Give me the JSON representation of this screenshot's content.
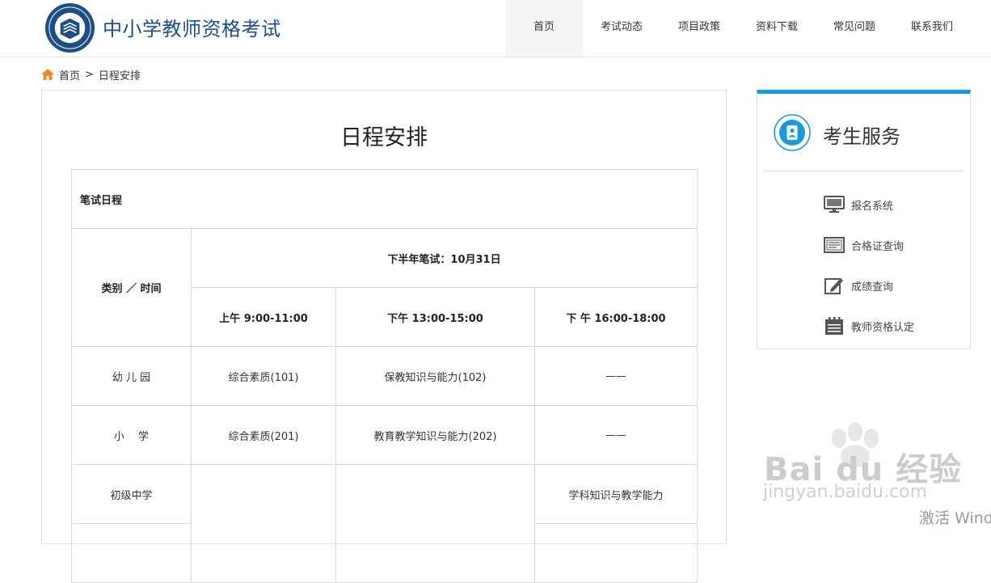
{
  "header": {
    "site_title": "中小学教师资格考试",
    "nav": [
      {
        "label": "首页",
        "active": true
      },
      {
        "label": "考试动态"
      },
      {
        "label": "项目政策"
      },
      {
        "label": "资料下载"
      },
      {
        "label": "常见问题"
      },
      {
        "label": "联系我们"
      }
    ]
  },
  "breadcrumb": {
    "home": "首页",
    "separator": ">",
    "current": "日程安排"
  },
  "main": {
    "title": "日程安排",
    "table": {
      "section_label": "笔试日程",
      "category_header": "类别 ／ 时间",
      "exam_date_header": "下半年笔试：10月31日",
      "time_slots": [
        "上午  9:00-11:00",
        "下午  13:00-15:00",
        "下 午  16:00-18:00"
      ],
      "rows": [
        {
          "category": "幼 儿 园",
          "cells": [
            "综合素质(101)",
            "保教知识与能力(102)",
            "——"
          ]
        },
        {
          "category": "小　 学",
          "cells": [
            "综合素质(201)",
            "教育教学知识与能力(202)",
            "——"
          ]
        },
        {
          "category": "初级中学",
          "cells": [
            "",
            "",
            "学科知识与教学能力"
          ]
        }
      ]
    }
  },
  "sidebar": {
    "title": "考生服务",
    "items": [
      {
        "label": "报名系统",
        "icon": "monitor-icon"
      },
      {
        "label": "合格证查询",
        "icon": "certificate-icon"
      },
      {
        "label": "成绩查询",
        "icon": "edit-icon"
      },
      {
        "label": "教师资格认定",
        "icon": "calendar-icon"
      }
    ]
  },
  "watermark": {
    "brand": "Bai du 经验",
    "url": "jingyan.baidu.com"
  },
  "os_overlay": "激活 Wind",
  "colors": {
    "brand_blue": "#1d4f84",
    "accent_blue": "#1a9ad6",
    "home_icon": "#f08a24"
  }
}
